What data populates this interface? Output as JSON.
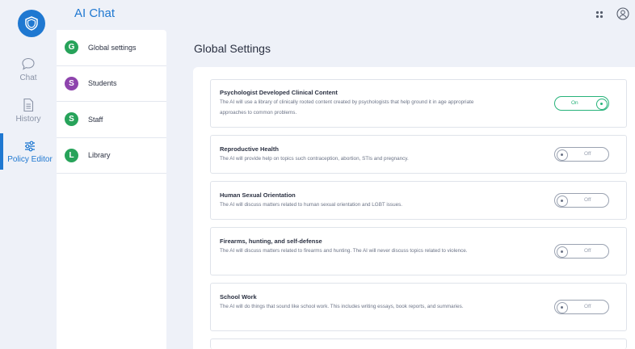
{
  "header": {
    "title": "AI Chat"
  },
  "rail": {
    "items": [
      {
        "label": "Chat",
        "icon": "chat-bubble-icon"
      },
      {
        "label": "History",
        "icon": "document-icon"
      },
      {
        "label": "Policy Editor",
        "icon": "sliders-icon",
        "active": true
      }
    ]
  },
  "subnav": {
    "items": [
      {
        "initial": "G",
        "label": "Global settings",
        "color": "#27a35a"
      },
      {
        "initial": "S",
        "label": "Students",
        "color": "#8e44ad"
      },
      {
        "initial": "S",
        "label": "Staff",
        "color": "#27a35a"
      },
      {
        "initial": "L",
        "label": "Library",
        "color": "#27a35a"
      }
    ]
  },
  "main": {
    "title": "Global Settings",
    "policies": [
      {
        "title": "Psychologist Developed Clinical Content",
        "desc": "The AI will use a library of clinically rooted content created by psychologists that help ground it in age appropriate approaches to common problems.",
        "state": "On"
      },
      {
        "title": "Reproductive Health",
        "desc": "The AI will provide help on topics such contraception, abortion, STIs and pregnancy.",
        "state": "Off"
      },
      {
        "title": "Human Sexual Orientation",
        "desc": "The AI will discuss matters related to human sexual orientation and LGBT issues.",
        "state": "Off"
      },
      {
        "title": "Firearms, hunting, and self-defense",
        "desc": "The AI will discuss matters related to firearms and hunting. The AI will never discuss topics related to violence.",
        "state": "Off"
      },
      {
        "title": "School Work",
        "desc": "The AI will do things that sound like school work. This includes writing essays, book reports, and summaries.",
        "state": "Off"
      }
    ]
  },
  "colors": {
    "accent": "#1f78d1",
    "on": "#27b37a",
    "off": "#9aa2b1"
  }
}
